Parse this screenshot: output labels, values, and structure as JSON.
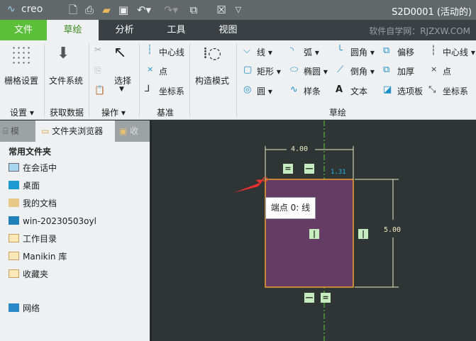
{
  "app": {
    "logo": "creo",
    "window_title": "S2D0001 (活动的)"
  },
  "quick_access": [
    "new-icon",
    "print-icon",
    "open-icon",
    "save-icon",
    "undo-icon",
    "redo-icon",
    "windows-icon",
    "close-window-icon",
    "customize-icon"
  ],
  "tabs": [
    {
      "label": "文件"
    },
    {
      "label": "草绘"
    },
    {
      "label": "分析"
    },
    {
      "label": "工具"
    },
    {
      "label": "视图"
    }
  ],
  "watermark": "软件自学网：RJZXW.COM",
  "ribbon": {
    "grid_settings": "栅格设置",
    "settings_group": "设置",
    "file_system": "文件系统",
    "get_data_group": "获取数据",
    "select": "选择",
    "operations_group": "操作",
    "centerline": "中心线",
    "point": "点",
    "coord_sys": "坐标系",
    "datum_group": "基准",
    "construction_mode": "构造模式",
    "line": "线",
    "arc": "弧",
    "fillet": "圆角",
    "offset": "偏移",
    "centerline2": "中心线",
    "rectangle": "矩形",
    "ellipse": "椭圆",
    "chamfer": "倒角",
    "thicken": "加厚",
    "point2": "点",
    "circle": "圆",
    "spline": "样条",
    "text": "文本",
    "palette": "选项板",
    "coord_sys2": "坐标系",
    "sketch_group": "草绘"
  },
  "panel": {
    "tabs": [
      "模",
      "文件夹浏览器",
      "收"
    ],
    "heading": "常用文件夹",
    "items": [
      {
        "label": "在会话中"
      },
      {
        "label": "桌面"
      },
      {
        "label": "我的文档"
      },
      {
        "label": "win-20230503oyl"
      },
      {
        "label": "工作目录"
      },
      {
        "label": "Manikin 库"
      },
      {
        "label": "收藏夹"
      },
      {
        "label": "网络"
      }
    ]
  },
  "sketch": {
    "width_dim": "4.00",
    "height_dim": "5.00",
    "offset_dim": "1.31",
    "tooltip": "端点 0: 线"
  },
  "colors": {
    "file_tab": "#5cbf3a",
    "rect_fill": "#643c64",
    "rect_edge": "#f0a030",
    "centerline": "#5fd03a"
  }
}
